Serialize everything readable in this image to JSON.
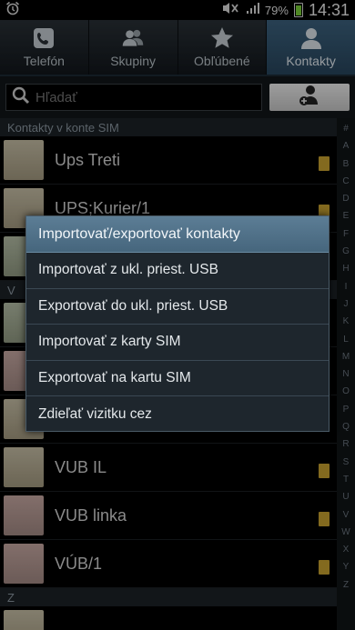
{
  "status": {
    "battery": "79%",
    "time": "14:31"
  },
  "tabs": [
    {
      "label": "Telefón",
      "icon": "phone-icon",
      "active": false
    },
    {
      "label": "Skupiny",
      "icon": "group-icon",
      "active": false
    },
    {
      "label": "Obľúbené",
      "icon": "star-icon",
      "active": false
    },
    {
      "label": "Kontakty",
      "icon": "person-icon",
      "active": true
    }
  ],
  "search": {
    "placeholder": "Hľadať"
  },
  "list": {
    "section_sim": "Kontakty v konte SIM",
    "contacts_top": [
      "Ups Treti",
      "UPS;Kurier/1"
    ],
    "section_v": "V",
    "contacts_bottom": [
      "VUB IL",
      "VUB linka",
      "VÚB/1"
    ],
    "section_z": "Z"
  },
  "index_letters": [
    "#",
    "A",
    "B",
    "C",
    "D",
    "E",
    "F",
    "G",
    "H",
    "I",
    "J",
    "K",
    "L",
    "M",
    "N",
    "O",
    "P",
    "Q",
    "R",
    "S",
    "T",
    "U",
    "V",
    "W",
    "X",
    "Y",
    "Z"
  ],
  "menu": {
    "title": "Importovať/exportovať kontakty",
    "items": [
      "Importovať z ukl. priest. USB",
      "Exportovať do ukl. priest. USB",
      "Importovať z karty SIM",
      "Exportovať na kartu SIM",
      "Zdieľať vizitku cez"
    ]
  }
}
